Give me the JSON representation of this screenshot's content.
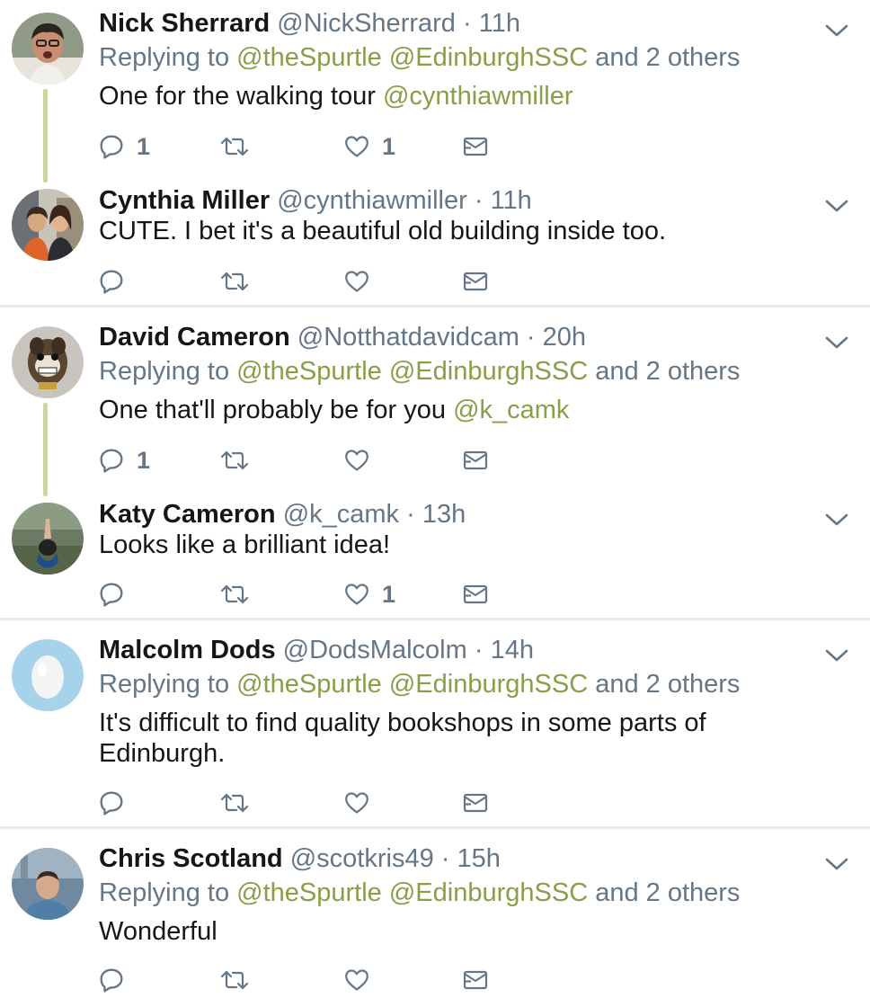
{
  "tweets": [
    {
      "name": "Nick Sherrard",
      "handle": "@NickSherrard",
      "dot": "·",
      "time": "11h",
      "replying_prefix": "Replying to",
      "reply_mentions": "@theSpurtle @EdinburghSSC",
      "reply_suffix": "and 2 others",
      "text": "One for the walking tour",
      "text_mention": "@cynthiawmiller",
      "reply_count": "1",
      "retweet_count": "",
      "like_count": "1"
    },
    {
      "name": "Cynthia Miller",
      "handle": "@cynthiawmiller",
      "dot": "·",
      "time": "11h",
      "text": "CUTE. I bet it's a beautiful old building inside too.",
      "reply_count": "",
      "retweet_count": "",
      "like_count": ""
    },
    {
      "name": "David Cameron",
      "handle": "@Notthatdavidcam",
      "dot": "·",
      "time": "20h",
      "replying_prefix": "Replying to",
      "reply_mentions": "@theSpurtle @EdinburghSSC",
      "reply_suffix": "and 2 others",
      "text": "One that'll probably be for you",
      "text_mention": "@k_camk",
      "reply_count": "1",
      "retweet_count": "",
      "like_count": ""
    },
    {
      "name": "Katy Cameron",
      "handle": "@k_camk",
      "dot": "·",
      "time": "13h",
      "text": "Looks like a brilliant idea!",
      "reply_count": "",
      "retweet_count": "",
      "like_count": "1"
    },
    {
      "name": "Malcolm Dods",
      "handle": "@DodsMalcolm",
      "dot": "·",
      "time": "14h",
      "replying_prefix": "Replying to",
      "reply_mentions": "@theSpurtle @EdinburghSSC",
      "reply_suffix": "and 2 others",
      "text_line1": "It's difficult to find quality bookshops in some parts of",
      "text_line2": "Edinburgh.",
      "reply_count": "",
      "retweet_count": "",
      "like_count": ""
    },
    {
      "name": "Chris Scotland",
      "handle": "@scotkris49",
      "dot": "·",
      "time": "15h",
      "replying_prefix": "Replying to",
      "reply_mentions": "@theSpurtle @EdinburghSSC",
      "reply_suffix": "and 2 others",
      "text": "Wonderful",
      "reply_count": "",
      "retweet_count": "",
      "like_count": ""
    }
  ],
  "icons": {
    "reply": "reply-icon",
    "retweet": "retweet-icon",
    "like": "like-icon",
    "dm": "direct-message-icon",
    "chevron": "chevron-down-icon"
  },
  "colors": {
    "mention": "#889f4a",
    "secondary_text": "#657786",
    "thread_line": "#c8d7a4",
    "separator": "#e6ecf0"
  }
}
